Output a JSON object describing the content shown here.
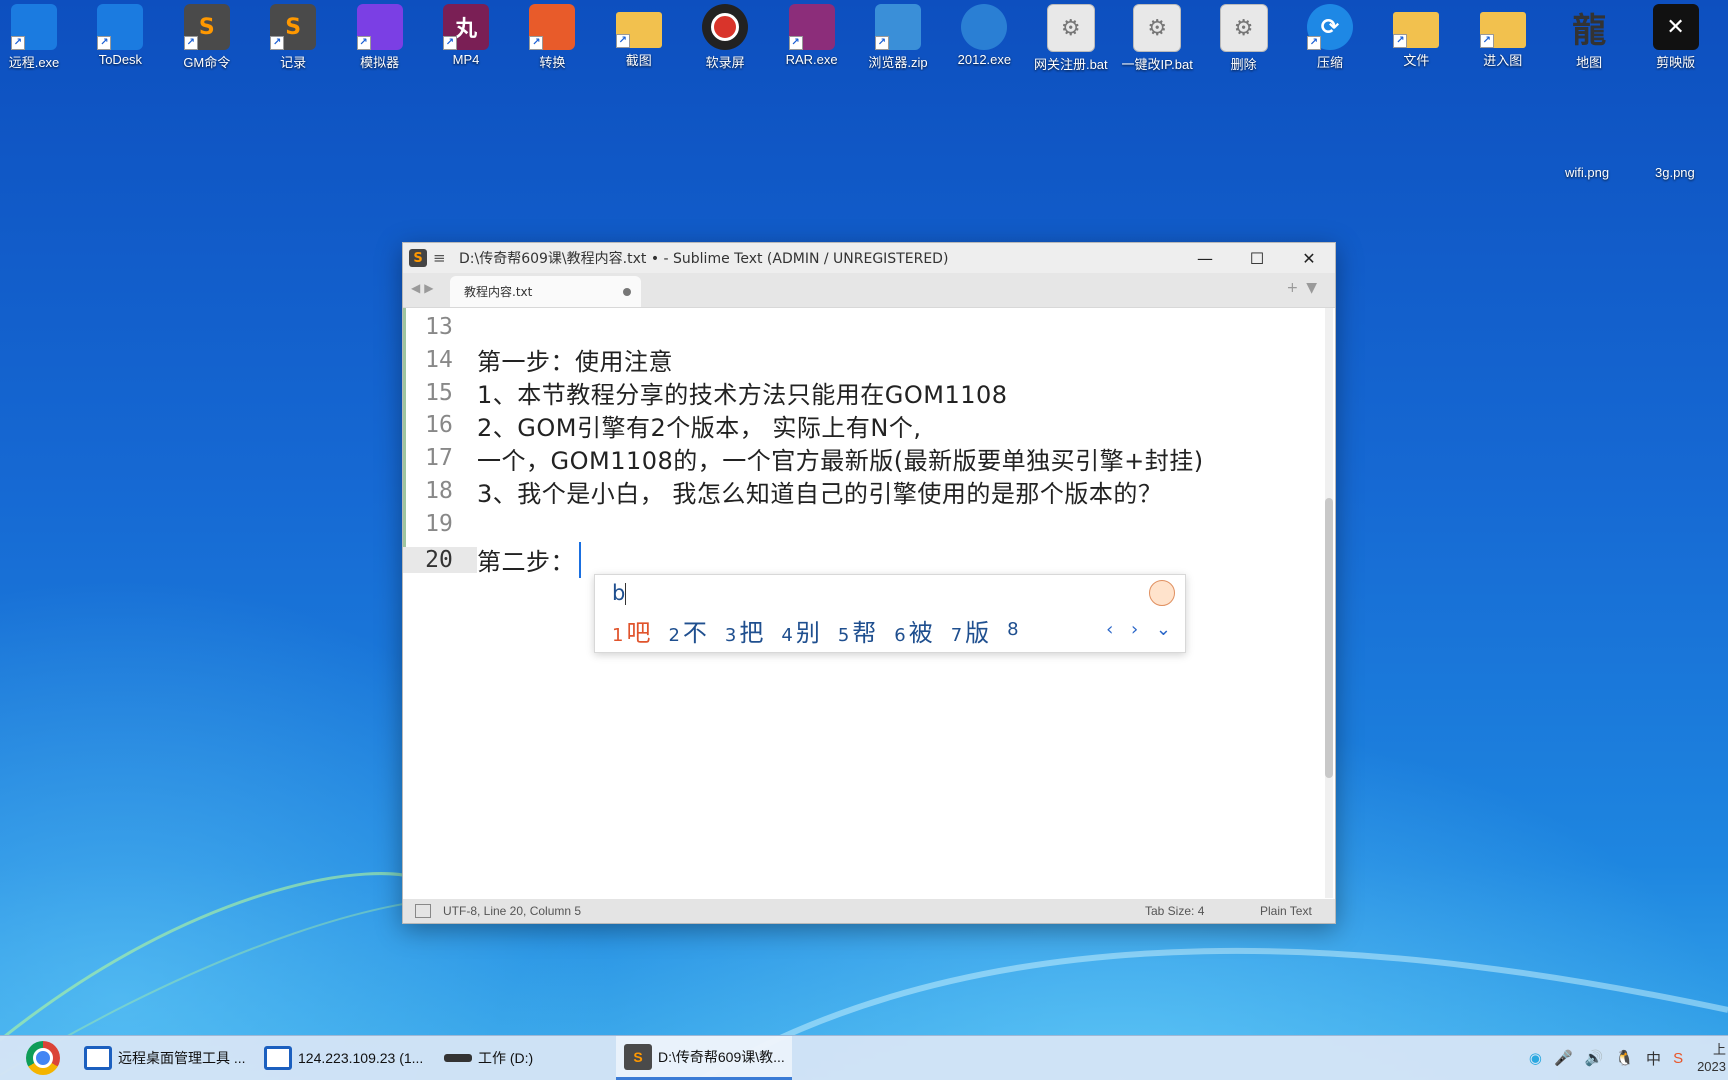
{
  "desktop": {
    "icons": [
      {
        "label": "远程.exe",
        "icon": "remote-icon",
        "color": "#1b7be0"
      },
      {
        "label": "ToDesk",
        "icon": "todesk-icon",
        "color": "#1b7be0"
      },
      {
        "label": "GM命令",
        "icon": "sublime-icon",
        "color": "#ff9800"
      },
      {
        "label": "记录",
        "icon": "sublime-icon",
        "color": "#ff9800"
      },
      {
        "label": "模拟器",
        "icon": "emulator-icon",
        "color": "#7b3fe4"
      },
      {
        "label": "MP4",
        "icon": "mp4-icon",
        "color": "#7a1f55"
      },
      {
        "label": "转换",
        "icon": "converter-icon",
        "color": "#e85b2a"
      },
      {
        "label": "截图",
        "icon": "folder-icon",
        "color": "#f2c14e"
      },
      {
        "label": "软录屏",
        "icon": "record-icon",
        "color": "#d9342b"
      },
      {
        "label": "RAR.exe",
        "icon": "winrar-icon",
        "color": "#8c2d7a"
      },
      {
        "label": "浏览器.zip",
        "icon": "zip-icon",
        "color": "#3a8fd8"
      },
      {
        "label": "2012.exe",
        "icon": "windows-icon",
        "color": "#2a7fd4"
      },
      {
        "label": "网关注册.bat",
        "icon": "batch-icon",
        "color": "#e8e8e8"
      },
      {
        "label": "一键改IP.bat",
        "icon": "batch-icon",
        "color": "#e8e8e8"
      },
      {
        "label": "删除",
        "icon": "batch-icon",
        "color": "#e8e8e8"
      },
      {
        "label": "压缩",
        "icon": "sync-icon",
        "color": "#1e88e5"
      },
      {
        "label": "文件",
        "icon": "folder-icon",
        "color": "#f2c14e"
      },
      {
        "label": "进入图",
        "icon": "folder-icon",
        "color": "#f2c14e"
      },
      {
        "label": "地图",
        "icon": "dragon-icon",
        "color": "#2e2e2e"
      },
      {
        "label": "剪映版",
        "icon": "capcut-icon",
        "color": "#111111"
      }
    ],
    "files": [
      {
        "label": "wifi.png"
      },
      {
        "label": "3g.png"
      }
    ]
  },
  "window": {
    "title": "D:\\传奇帮609课\\教程内容.txt • - Sublime Text (ADMIN / UNREGISTERED)",
    "minimize": "—",
    "maximize": "☐",
    "close": "✕",
    "tab": {
      "label": "教程内容.txt"
    },
    "lines": [
      {
        "num": "13",
        "text": ""
      },
      {
        "num": "14",
        "text": "第一步：使用注意"
      },
      {
        "num": "15",
        "text": "1、本节教程分享的技术方法只能用在GOM1108"
      },
      {
        "num": "16",
        "text": "2、GOM引擎有2个版本， 实际上有N个,"
      },
      {
        "num": "17",
        "text": "一个，GOM1108的，一个官方最新版(最新版要单独买引擎+封挂)"
      },
      {
        "num": "18",
        "text": "3、我个是小白， 我怎么知道自己的引擎使用的是那个版本的？"
      },
      {
        "num": "19",
        "text": ""
      },
      {
        "num": "20",
        "text": "第二步："
      }
    ],
    "status": {
      "position": "UTF-8, Line 20, Column 5",
      "tab_size": "Tab Size: 4",
      "syntax": "Plain Text"
    }
  },
  "ime": {
    "composition": "b",
    "candidates": [
      {
        "n": "1",
        "text": "吧"
      },
      {
        "n": "2",
        "text": "不"
      },
      {
        "n": "3",
        "text": "把"
      },
      {
        "n": "4",
        "text": "别"
      },
      {
        "n": "5",
        "text": "帮"
      },
      {
        "n": "6",
        "text": "被"
      },
      {
        "n": "7",
        "text": "版"
      },
      {
        "n": "8",
        "text": ""
      }
    ]
  },
  "taskbar": {
    "items": [
      {
        "label": "远程桌面管理工具 ..."
      },
      {
        "label": "124.223.109.23 (1..."
      },
      {
        "label": "工作 (D:)"
      },
      {
        "label": "D:\\传奇帮609课\\教..."
      }
    ],
    "clock_time": "上",
    "clock_date": "2023"
  },
  "colors": {
    "accent": "#1a6fe0",
    "ime_selected": "#e0542c",
    "ime_text": "#1f4f8f"
  }
}
